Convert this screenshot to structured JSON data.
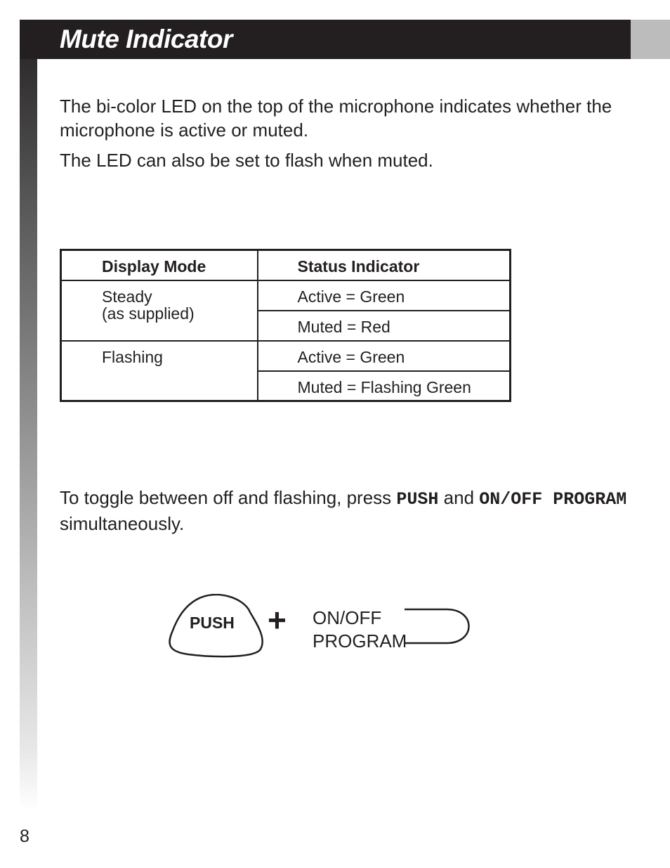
{
  "header": {
    "title": "Mute Indicator",
    "bar_color": "#231f20",
    "tab_color": "#bcbcbc"
  },
  "intro": {
    "paragraph1": "The bi-color LED on the top of the microphone indicates whether the microphone is active or muted.",
    "paragraph2": "The LED can also be set to flash when muted."
  },
  "table": {
    "headers": [
      "Display Mode",
      "Status Indicator"
    ],
    "rows": [
      {
        "mode_line1": "Steady",
        "mode_line2": "(as supplied)",
        "statuses": [
          "Active = Green",
          "Muted = Red"
        ]
      },
      {
        "mode_line1": "Flashing",
        "mode_line2": "",
        "statuses": [
          "Active = Green",
          "Muted = Flashing Green"
        ]
      }
    ]
  },
  "instructions": {
    "text_before": "To toggle between off and flashing, press ",
    "button1": "PUSH",
    "text_middle": " and ",
    "button2": "ON/OFF PROGRAM",
    "text_after": " simultaneously."
  },
  "diagram": {
    "push_label": "PUSH",
    "plus_symbol": "+",
    "switch_label_line1": "ON/OFF",
    "switch_label_line2": "PROGRAM"
  },
  "footer": {
    "page_number": "8"
  }
}
